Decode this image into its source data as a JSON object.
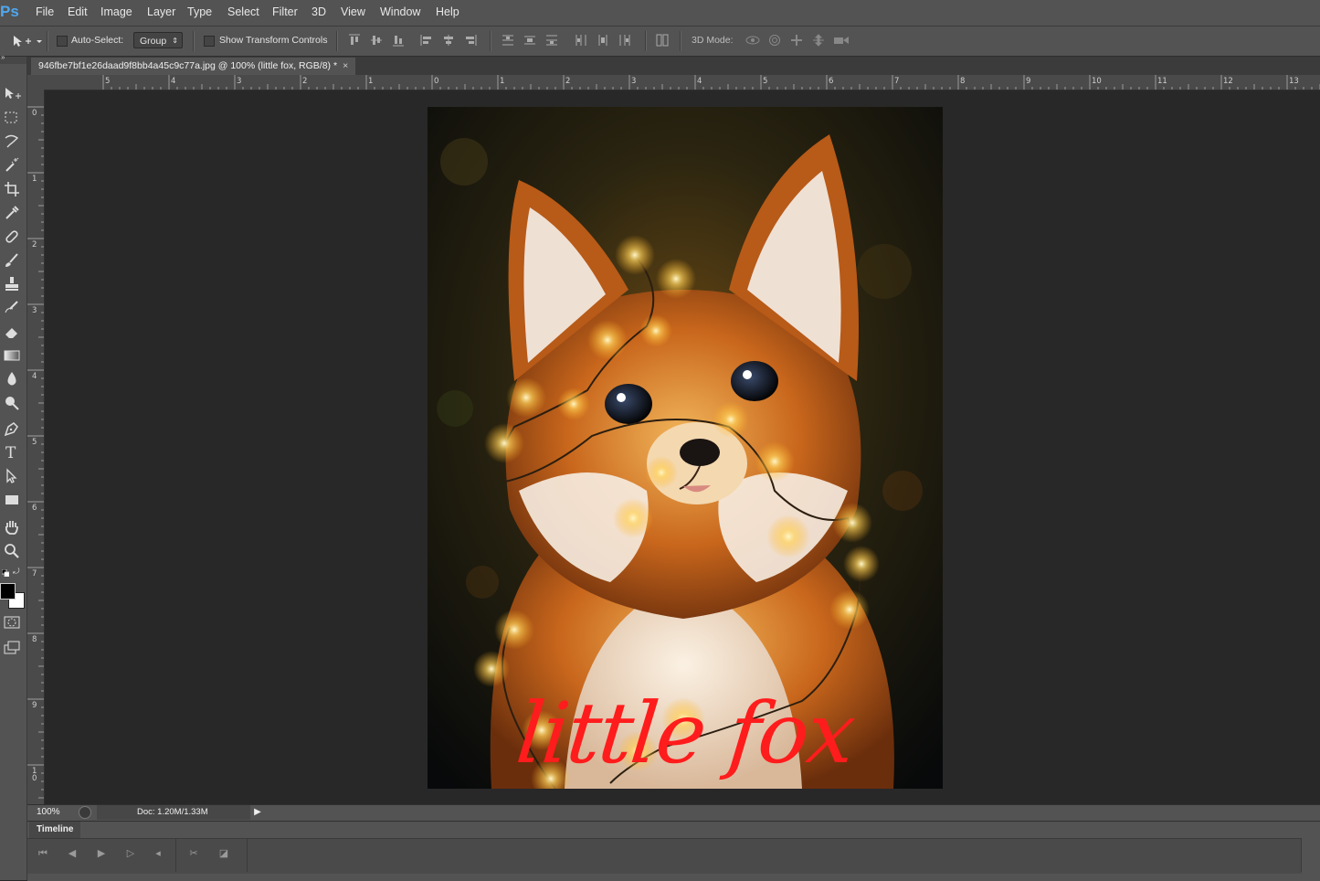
{
  "app": {
    "logo": "Ps"
  },
  "menu": [
    "File",
    "Edit",
    "Image",
    "Layer",
    "Type",
    "Select",
    "Filter",
    "3D",
    "View",
    "Window",
    "Help"
  ],
  "options": {
    "auto_select_label": "Auto-Select:",
    "auto_select_checked": false,
    "group_value": "Group",
    "show_transform_label": "Show Transform Controls",
    "show_transform_checked": false,
    "mode_3d_label": "3D Mode:"
  },
  "document_tab": {
    "title": "946fbe7bf1e26daad9f8bb4a45c9c77a.jpg @ 100% (little fox, RGB/8) *",
    "close": "×"
  },
  "rulers": {
    "horizontal": [
      "5",
      "4",
      "3",
      "2",
      "1",
      "0",
      "1",
      "2",
      "3",
      "4",
      "5",
      "6",
      "7",
      "8",
      "9",
      "10",
      "11",
      "12",
      "13"
    ],
    "vertical": [
      "0",
      "1",
      "2",
      "3",
      "4",
      "5",
      "6",
      "7",
      "8",
      "9",
      "1\n0"
    ]
  },
  "canvas": {
    "overlay_text": "little fox",
    "overlay_color": "#ff1c1c"
  },
  "status": {
    "zoom": "100%",
    "doc_info": "Doc: 1.20M/1.33M"
  },
  "timeline": {
    "tab_label": "Timeline"
  },
  "icons": {
    "tools": [
      "move-icon",
      "marquee-icon",
      "lasso-icon",
      "magic-wand-icon",
      "crop-icon",
      "eyedropper-icon",
      "healing-brush-icon",
      "brush-icon",
      "clone-stamp-icon",
      "history-brush-icon",
      "eraser-icon",
      "gradient-icon",
      "blur-icon",
      "dodge-icon",
      "pen-icon",
      "type-icon",
      "path-selection-icon",
      "rectangle-icon",
      "hand-icon",
      "zoom-icon"
    ]
  }
}
